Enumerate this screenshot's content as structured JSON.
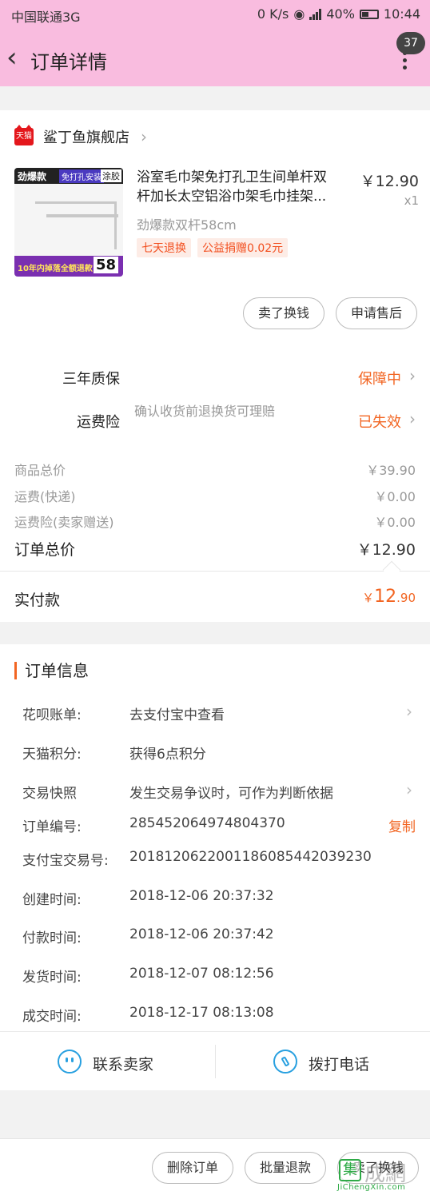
{
  "status_bar": {
    "carrier": "中国联通3G",
    "speed": "0 K/s",
    "battery": "40%",
    "time": "10:44"
  },
  "header": {
    "title": "订单详情",
    "badge": "37"
  },
  "shop": {
    "tmall_logo": "天猫",
    "name": "鲨丁鱼旗舰店"
  },
  "product": {
    "thumb": {
      "tag1": "劲爆款",
      "tag2": "免打孔安装",
      "tag3": "涂胶",
      "bottom_text": "10年内掉落全额退款!",
      "size": "58"
    },
    "title_line1": "浴室毛巾架免打孔卫生间单杆双",
    "title_line2": "杆加长太空铝浴巾架毛巾挂架...",
    "price": "￥12.90",
    "qty": "x1",
    "spec": "劲爆款双杆58cm",
    "tags": [
      "七天退换",
      "公益捐赠0.02元"
    ],
    "buttons": [
      "卖了换钱",
      "申请售后"
    ]
  },
  "services": [
    {
      "name": "三年质保",
      "desc": "",
      "status": "保障中"
    },
    {
      "name": "运费险",
      "desc": "确认收货前退换货可理赔",
      "status": "已失效"
    }
  ],
  "fees": [
    {
      "label": "商品总价",
      "value": "￥39.90"
    },
    {
      "label": "运费(快递)",
      "value": "￥0.00"
    },
    {
      "label": "运费险(卖家赠送)",
      "value": "￥0.00"
    }
  ],
  "total": {
    "label": "订单总价",
    "value": "￥12.90"
  },
  "paid": {
    "label": "实付款",
    "currency": "￥",
    "int": "12",
    "dec": ".90"
  },
  "order_info": {
    "title": "订单信息",
    "rows": [
      {
        "key": "花呗账单:",
        "value": "去支付宝中查看"
      },
      {
        "key": "天猫积分:",
        "value": "获得6点积分"
      },
      {
        "key": "交易快照",
        "value": "发生交易争议时，可作为判断依据"
      },
      {
        "key": "订单编号:",
        "value": "285452064974804370",
        "action": "复制"
      },
      {
        "key": "支付宝交易号:",
        "value": "2018120622001186085442039230"
      },
      {
        "key": "创建时间:",
        "value": "2018-12-06 20:37:32"
      },
      {
        "key": "付款时间:",
        "value": "2018-12-06 20:37:42"
      },
      {
        "key": "发货时间:",
        "value": "2018-12-07 08:12:56"
      },
      {
        "key": "成交时间:",
        "value": "2018-12-17 08:13:08"
      }
    ]
  },
  "contact": {
    "seller": "联系卖家",
    "phone": "拨打电话"
  },
  "bottom_buttons": [
    "删除订单",
    "批量退款",
    "卖了换钱"
  ],
  "watermark": {
    "logo_char": "集",
    "cn": "成網",
    "en": "JiChengXin.com"
  }
}
